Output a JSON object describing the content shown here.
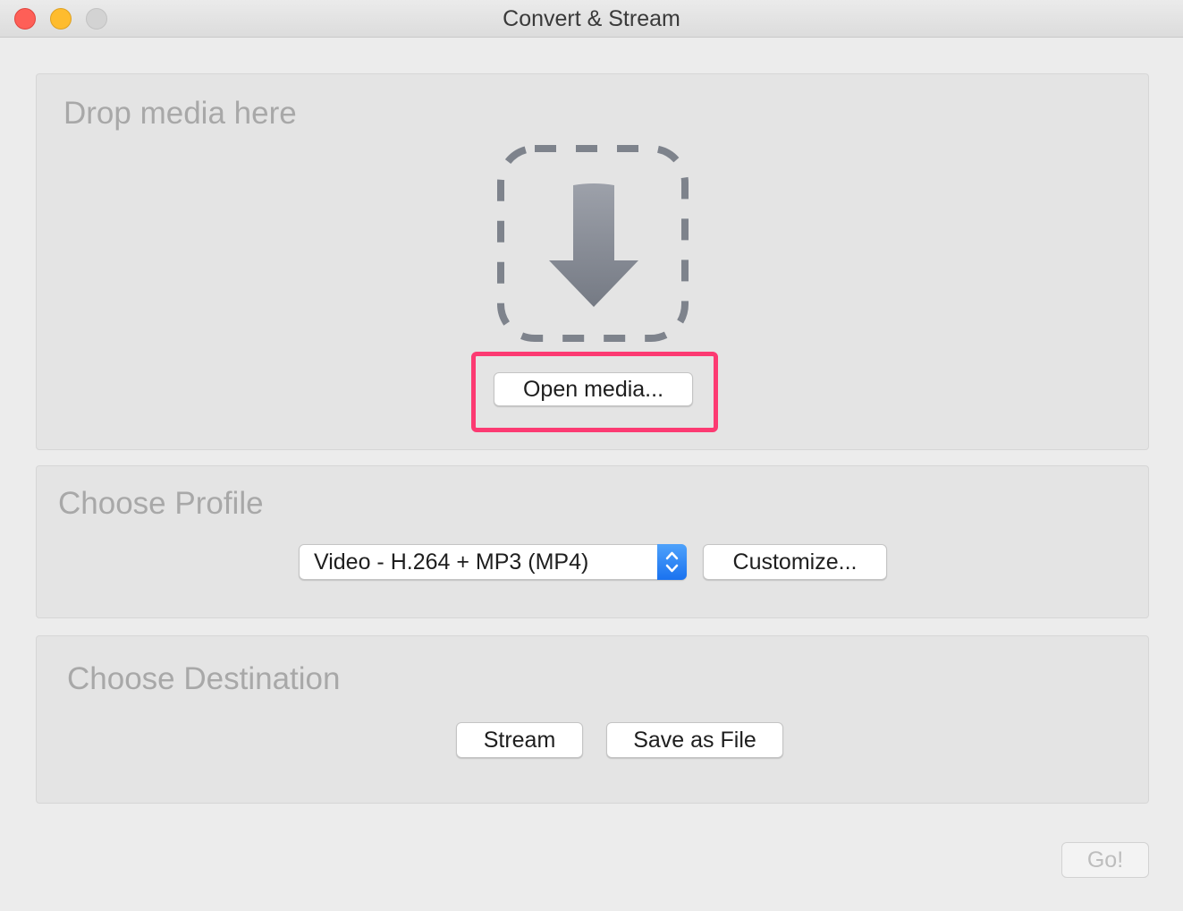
{
  "window": {
    "title": "Convert & Stream"
  },
  "drop_section": {
    "title": "Drop media here",
    "open_media_label": "Open media..."
  },
  "profile_section": {
    "title": "Choose Profile",
    "selected_profile": "Video - H.264 + MP3 (MP4)",
    "customize_label": "Customize..."
  },
  "destination_section": {
    "title": "Choose Destination",
    "stream_label": "Stream",
    "save_as_file_label": "Save as File"
  },
  "footer": {
    "go_label": "Go!"
  },
  "colors": {
    "highlight": "#fc3a72",
    "accent": "#1a72ef",
    "close": "#fe5f57",
    "minimize": "#febc2e"
  },
  "icons": {
    "drop_zone": "download-arrow-icon",
    "select_stepper": "chevron-updown-icon"
  }
}
